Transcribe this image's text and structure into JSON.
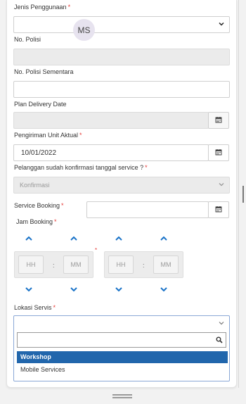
{
  "avatar": {
    "initials": "MS"
  },
  "fields": {
    "jenis_penggunaan": {
      "label": "Jenis Penggunaan",
      "required": "*",
      "value": ""
    },
    "no_polisi": {
      "label": "No. Polisi",
      "value": ""
    },
    "no_polisi_sementara": {
      "label": "No. Polisi Sementara",
      "value": ""
    },
    "plan_delivery_date": {
      "label": "Plan Delivery Date",
      "value": ""
    },
    "pengiriman_unit_aktual": {
      "label": "Pengiriman Unit Aktual",
      "required": "*",
      "value": "10/01/2022"
    },
    "pelanggan_konfirmasi": {
      "label": "Pelanggan sudah konfirmasi tanggal service ?",
      "required": "*",
      "placeholder": "Konfirmasi"
    },
    "service_booking": {
      "label": "Service Booking",
      "required": "*",
      "value": ""
    },
    "jam_booking": {
      "label": "Jam Booking",
      "required": "*",
      "start": {
        "hours_placeholder": "HH",
        "minutes_placeholder": "MM",
        "separator": ":"
      },
      "end": {
        "hours_placeholder": "HH",
        "minutes_placeholder": "MM",
        "separator": ":"
      },
      "middle_marker": "*"
    },
    "lokasi_servis": {
      "label": "Lokasi Servis",
      "required": "*",
      "value": "",
      "search_value": "",
      "options": [
        {
          "label": "Workshop",
          "selected": true
        },
        {
          "label": "Mobile Services",
          "selected": false
        }
      ]
    }
  },
  "icons": {
    "calendar": "calendar-icon",
    "chevron": "chevron-down-icon",
    "search": "search-icon",
    "spin_up": "chevron-up-icon",
    "spin_down": "chevron-down-icon"
  },
  "colors": {
    "required": "#e53935",
    "accent": "#1a73c8",
    "selected_option": "#2166ac"
  }
}
